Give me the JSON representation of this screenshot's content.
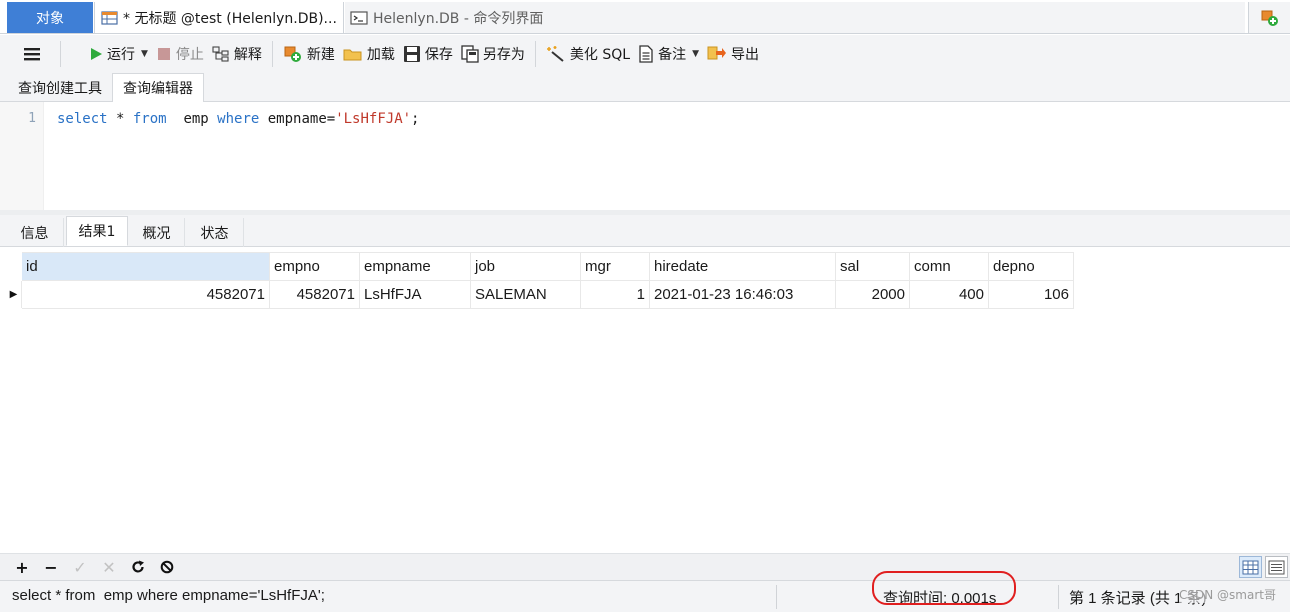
{
  "tabs": {
    "objects": "对象",
    "untitled": "* 无标题 @test (Helenlyn.DB)...",
    "command": "Helenlyn.DB - 命令列界面"
  },
  "toolbar": {
    "run": "运行",
    "stop": "停止",
    "explain": "解释",
    "new": "新建",
    "load": "加载",
    "save": "保存",
    "save_as": "另存为",
    "beautify": "美化 SQL",
    "comment": "备注",
    "export": "导出"
  },
  "editor_tabs": {
    "builder": "查询创建工具",
    "editor": "查询编辑器"
  },
  "editor": {
    "line_number": "1",
    "select": "select",
    "star": " * ",
    "from": "from",
    "table": "  emp ",
    "where": "where",
    "condition": " empname=",
    "literal": "'LsHfFJA'",
    "end": ";"
  },
  "result_tabs": {
    "info": "信息",
    "result1": "结果1",
    "profile": "概况",
    "status": "状态"
  },
  "grid": {
    "columns": [
      "id",
      "empno",
      "empname",
      "job",
      "mgr",
      "hiredate",
      "sal",
      "comn",
      "depno"
    ],
    "rows": [
      [
        "4582071",
        "4582071",
        "LsHfFJA",
        "SALEMAN",
        "1",
        "2021-01-23 16:46:03",
        "2000",
        "400",
        "106"
      ]
    ]
  },
  "status": {
    "sql": "select * from  emp where empname='LsHfFJA';",
    "query_time": "查询时间: 0.001s",
    "records": "第 1 条记录 (共 1 条)"
  },
  "watermark": "CSDN @smart哥",
  "colors": {
    "accent": "#3f7fd6",
    "keyword": "#2a72c6",
    "string_literal": "#c0392b",
    "highlight_ring": "#e01f1f",
    "run_icon": "#2eaa3c"
  }
}
